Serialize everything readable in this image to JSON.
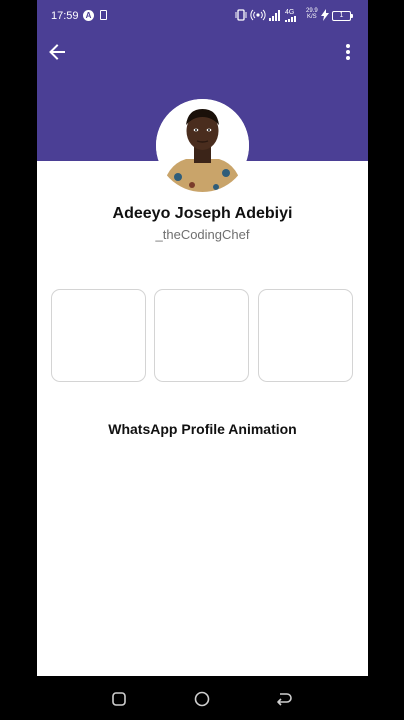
{
  "status_bar": {
    "time": "17:59",
    "app_badge": "A",
    "network": "4G",
    "speed_top": "29.9",
    "speed_bottom": "K/S",
    "battery": "1"
  },
  "header": {
    "back_icon": "arrow-left-icon",
    "more_icon": "more-vert-icon",
    "color": "#4b3f95"
  },
  "profile": {
    "name": "Adeeyo Joseph Adebiyi",
    "handle": "_theCodingChef"
  },
  "caption": "WhatsApp Profile Animation",
  "nav": {
    "recent_icon": "square-icon",
    "home_icon": "circle-icon",
    "back_icon": "return-icon"
  }
}
